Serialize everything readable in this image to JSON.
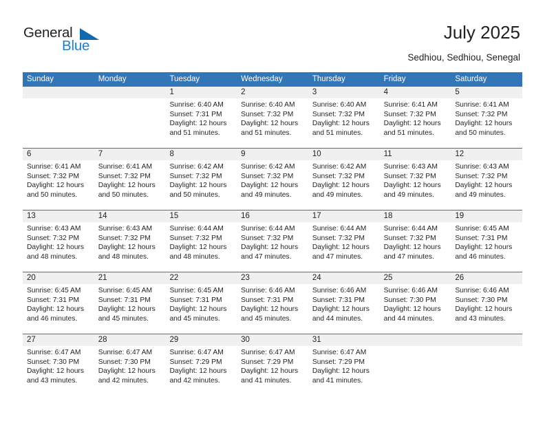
{
  "logo": {
    "word_top": "General",
    "word_bottom": "Blue",
    "triangle_icon": "triangle-icon",
    "blue": "#1b7fd4"
  },
  "header": {
    "title": "July 2025",
    "subtitle": "Sedhiou, Sedhiou, Senegal"
  },
  "theme": {
    "header_blue": "#3276b8",
    "daynum_band": "#f0f0f0",
    "text": "#231f20"
  },
  "calendar": {
    "weekday_headers": [
      "Sunday",
      "Monday",
      "Tuesday",
      "Wednesday",
      "Thursday",
      "Friday",
      "Saturday"
    ],
    "weeks": [
      [
        {
          "day": "",
          "lines": []
        },
        {
          "day": "",
          "lines": []
        },
        {
          "day": "1",
          "lines": [
            "Sunrise: 6:40 AM",
            "Sunset: 7:31 PM",
            "Daylight: 12 hours",
            "and 51 minutes."
          ]
        },
        {
          "day": "2",
          "lines": [
            "Sunrise: 6:40 AM",
            "Sunset: 7:32 PM",
            "Daylight: 12 hours",
            "and 51 minutes."
          ]
        },
        {
          "day": "3",
          "lines": [
            "Sunrise: 6:40 AM",
            "Sunset: 7:32 PM",
            "Daylight: 12 hours",
            "and 51 minutes."
          ]
        },
        {
          "day": "4",
          "lines": [
            "Sunrise: 6:41 AM",
            "Sunset: 7:32 PM",
            "Daylight: 12 hours",
            "and 51 minutes."
          ]
        },
        {
          "day": "5",
          "lines": [
            "Sunrise: 6:41 AM",
            "Sunset: 7:32 PM",
            "Daylight: 12 hours",
            "and 50 minutes."
          ]
        }
      ],
      [
        {
          "day": "6",
          "lines": [
            "Sunrise: 6:41 AM",
            "Sunset: 7:32 PM",
            "Daylight: 12 hours",
            "and 50 minutes."
          ]
        },
        {
          "day": "7",
          "lines": [
            "Sunrise: 6:41 AM",
            "Sunset: 7:32 PM",
            "Daylight: 12 hours",
            "and 50 minutes."
          ]
        },
        {
          "day": "8",
          "lines": [
            "Sunrise: 6:42 AM",
            "Sunset: 7:32 PM",
            "Daylight: 12 hours",
            "and 50 minutes."
          ]
        },
        {
          "day": "9",
          "lines": [
            "Sunrise: 6:42 AM",
            "Sunset: 7:32 PM",
            "Daylight: 12 hours",
            "and 49 minutes."
          ]
        },
        {
          "day": "10",
          "lines": [
            "Sunrise: 6:42 AM",
            "Sunset: 7:32 PM",
            "Daylight: 12 hours",
            "and 49 minutes."
          ]
        },
        {
          "day": "11",
          "lines": [
            "Sunrise: 6:43 AM",
            "Sunset: 7:32 PM",
            "Daylight: 12 hours",
            "and 49 minutes."
          ]
        },
        {
          "day": "12",
          "lines": [
            "Sunrise: 6:43 AM",
            "Sunset: 7:32 PM",
            "Daylight: 12 hours",
            "and 49 minutes."
          ]
        }
      ],
      [
        {
          "day": "13",
          "lines": [
            "Sunrise: 6:43 AM",
            "Sunset: 7:32 PM",
            "Daylight: 12 hours",
            "and 48 minutes."
          ]
        },
        {
          "day": "14",
          "lines": [
            "Sunrise: 6:43 AM",
            "Sunset: 7:32 PM",
            "Daylight: 12 hours",
            "and 48 minutes."
          ]
        },
        {
          "day": "15",
          "lines": [
            "Sunrise: 6:44 AM",
            "Sunset: 7:32 PM",
            "Daylight: 12 hours",
            "and 48 minutes."
          ]
        },
        {
          "day": "16",
          "lines": [
            "Sunrise: 6:44 AM",
            "Sunset: 7:32 PM",
            "Daylight: 12 hours",
            "and 47 minutes."
          ]
        },
        {
          "day": "17",
          "lines": [
            "Sunrise: 6:44 AM",
            "Sunset: 7:32 PM",
            "Daylight: 12 hours",
            "and 47 minutes."
          ]
        },
        {
          "day": "18",
          "lines": [
            "Sunrise: 6:44 AM",
            "Sunset: 7:32 PM",
            "Daylight: 12 hours",
            "and 47 minutes."
          ]
        },
        {
          "day": "19",
          "lines": [
            "Sunrise: 6:45 AM",
            "Sunset: 7:31 PM",
            "Daylight: 12 hours",
            "and 46 minutes."
          ]
        }
      ],
      [
        {
          "day": "20",
          "lines": [
            "Sunrise: 6:45 AM",
            "Sunset: 7:31 PM",
            "Daylight: 12 hours",
            "and 46 minutes."
          ]
        },
        {
          "day": "21",
          "lines": [
            "Sunrise: 6:45 AM",
            "Sunset: 7:31 PM",
            "Daylight: 12 hours",
            "and 45 minutes."
          ]
        },
        {
          "day": "22",
          "lines": [
            "Sunrise: 6:45 AM",
            "Sunset: 7:31 PM",
            "Daylight: 12 hours",
            "and 45 minutes."
          ]
        },
        {
          "day": "23",
          "lines": [
            "Sunrise: 6:46 AM",
            "Sunset: 7:31 PM",
            "Daylight: 12 hours",
            "and 45 minutes."
          ]
        },
        {
          "day": "24",
          "lines": [
            "Sunrise: 6:46 AM",
            "Sunset: 7:31 PM",
            "Daylight: 12 hours",
            "and 44 minutes."
          ]
        },
        {
          "day": "25",
          "lines": [
            "Sunrise: 6:46 AM",
            "Sunset: 7:30 PM",
            "Daylight: 12 hours",
            "and 44 minutes."
          ]
        },
        {
          "day": "26",
          "lines": [
            "Sunrise: 6:46 AM",
            "Sunset: 7:30 PM",
            "Daylight: 12 hours",
            "and 43 minutes."
          ]
        }
      ],
      [
        {
          "day": "27",
          "lines": [
            "Sunrise: 6:47 AM",
            "Sunset: 7:30 PM",
            "Daylight: 12 hours",
            "and 43 minutes."
          ]
        },
        {
          "day": "28",
          "lines": [
            "Sunrise: 6:47 AM",
            "Sunset: 7:30 PM",
            "Daylight: 12 hours",
            "and 42 minutes."
          ]
        },
        {
          "day": "29",
          "lines": [
            "Sunrise: 6:47 AM",
            "Sunset: 7:29 PM",
            "Daylight: 12 hours",
            "and 42 minutes."
          ]
        },
        {
          "day": "30",
          "lines": [
            "Sunrise: 6:47 AM",
            "Sunset: 7:29 PM",
            "Daylight: 12 hours",
            "and 41 minutes."
          ]
        },
        {
          "day": "31",
          "lines": [
            "Sunrise: 6:47 AM",
            "Sunset: 7:29 PM",
            "Daylight: 12 hours",
            "and 41 minutes."
          ]
        },
        {
          "day": "",
          "lines": []
        },
        {
          "day": "",
          "lines": []
        }
      ]
    ]
  }
}
